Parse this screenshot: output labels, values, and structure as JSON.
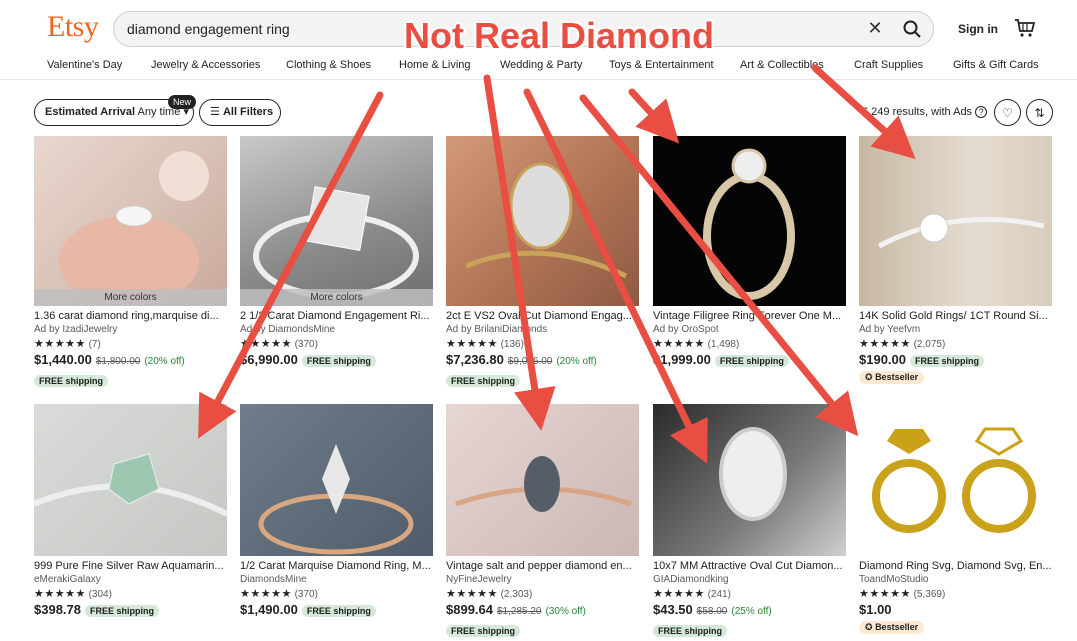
{
  "header": {
    "logo": "Etsy",
    "search_value": "diamond engagement ring",
    "signin_label": "Sign in"
  },
  "nav": [
    "Valentine's Day",
    "Jewelry & Accessories",
    "Clothing & Shoes",
    "Home & Living",
    "Wedding & Party",
    "Toys & Entertainment",
    "Art & Collectibles",
    "Craft Supplies",
    "Gifts & Gift Cards"
  ],
  "filters": {
    "estimated_arrival_label": "Estimated Arrival",
    "estimated_arrival_value": "Any time",
    "new_badge": "New",
    "all_filters_label": "All Filters",
    "results_text": "6,249 results, with Ads"
  },
  "annotation": {
    "title": "Not Real Diamond",
    "color": "#e94e43"
  },
  "listings": [
    {
      "title": "1.36 carat diamond ring,marquise di...",
      "seller": "Ad by IzadiJewelry",
      "stars": "★★★★★",
      "reviews": "(7)",
      "price": "$1,440.00",
      "old_price": "$1,800.00",
      "discount": "(20% off)",
      "free_shipping": "FREE shipping",
      "overlay": "More colors"
    },
    {
      "title": "2 1/2 Carat Diamond Engagement Ri...",
      "seller": "Ad by DiamondsMine",
      "stars": "★★★★★",
      "reviews": "(370)",
      "price": "$6,990.00",
      "free_shipping": "FREE shipping",
      "overlay": "More colors"
    },
    {
      "title": "2ct E VS2 Oval Cut Diamond Engag...",
      "seller": "Ad by BrilaniDiamonds",
      "stars": "★★★★★",
      "reviews": "(136)",
      "price": "$7,236.80",
      "old_price": "$9,046.00",
      "discount": "(20% off)",
      "free_shipping": "FREE shipping"
    },
    {
      "title": "Vintage Filigree Ring Forever One M...",
      "seller": "Ad by OroSpot",
      "stars": "★★★★★",
      "reviews": "(1,498)",
      "price": "$1,999.00",
      "free_shipping": "FREE shipping"
    },
    {
      "title": "14K Solid Gold Rings/ 1CT Round Si...",
      "seller": "Ad by Yeefvm",
      "stars": "★★★★★",
      "reviews": "(2,075)",
      "price": "$190.00",
      "free_shipping": "FREE shipping",
      "badge": "Bestseller"
    },
    {
      "title": "999 Pure Fine Silver Raw Aquamarin...",
      "seller": "eMerakiGalaxy",
      "stars": "★★★★★",
      "reviews": "(304)",
      "price": "$398.78",
      "free_shipping": "FREE shipping"
    },
    {
      "title": "1/2 Carat Marquise Diamond Ring, M...",
      "seller": "DiamondsMine",
      "stars": "★★★★★",
      "reviews": "(370)",
      "price": "$1,490.00",
      "free_shipping": "FREE shipping"
    },
    {
      "title": "Vintage salt and pepper diamond en...",
      "seller": "NyFineJewelry",
      "stars": "★★★★★",
      "reviews": "(2,303)",
      "price": "$899.64",
      "old_price": "$1,285.20",
      "discount": "(30% off)",
      "free_shipping": "FREE shipping"
    },
    {
      "title": "10x7 MM Attractive Oval Cut Diamon...",
      "seller": "GIADiamondking",
      "stars": "★★★★★",
      "reviews": "(241)",
      "price": "$43.50",
      "old_price": "$58.00",
      "discount": "(25% off)",
      "free_shipping": "FREE shipping"
    },
    {
      "title": "Diamond Ring Svg, Diamond Svg, En...",
      "seller": "ToandMoStudio",
      "stars": "★★★★★",
      "reviews": "(5,369)",
      "price": "$1.00",
      "badge": "Bestseller"
    }
  ],
  "colors": {
    "brand": "#f1641e",
    "arrow": "#e94e43",
    "free_bg": "#d4e9d7",
    "best_bg": "#fde9d2"
  }
}
